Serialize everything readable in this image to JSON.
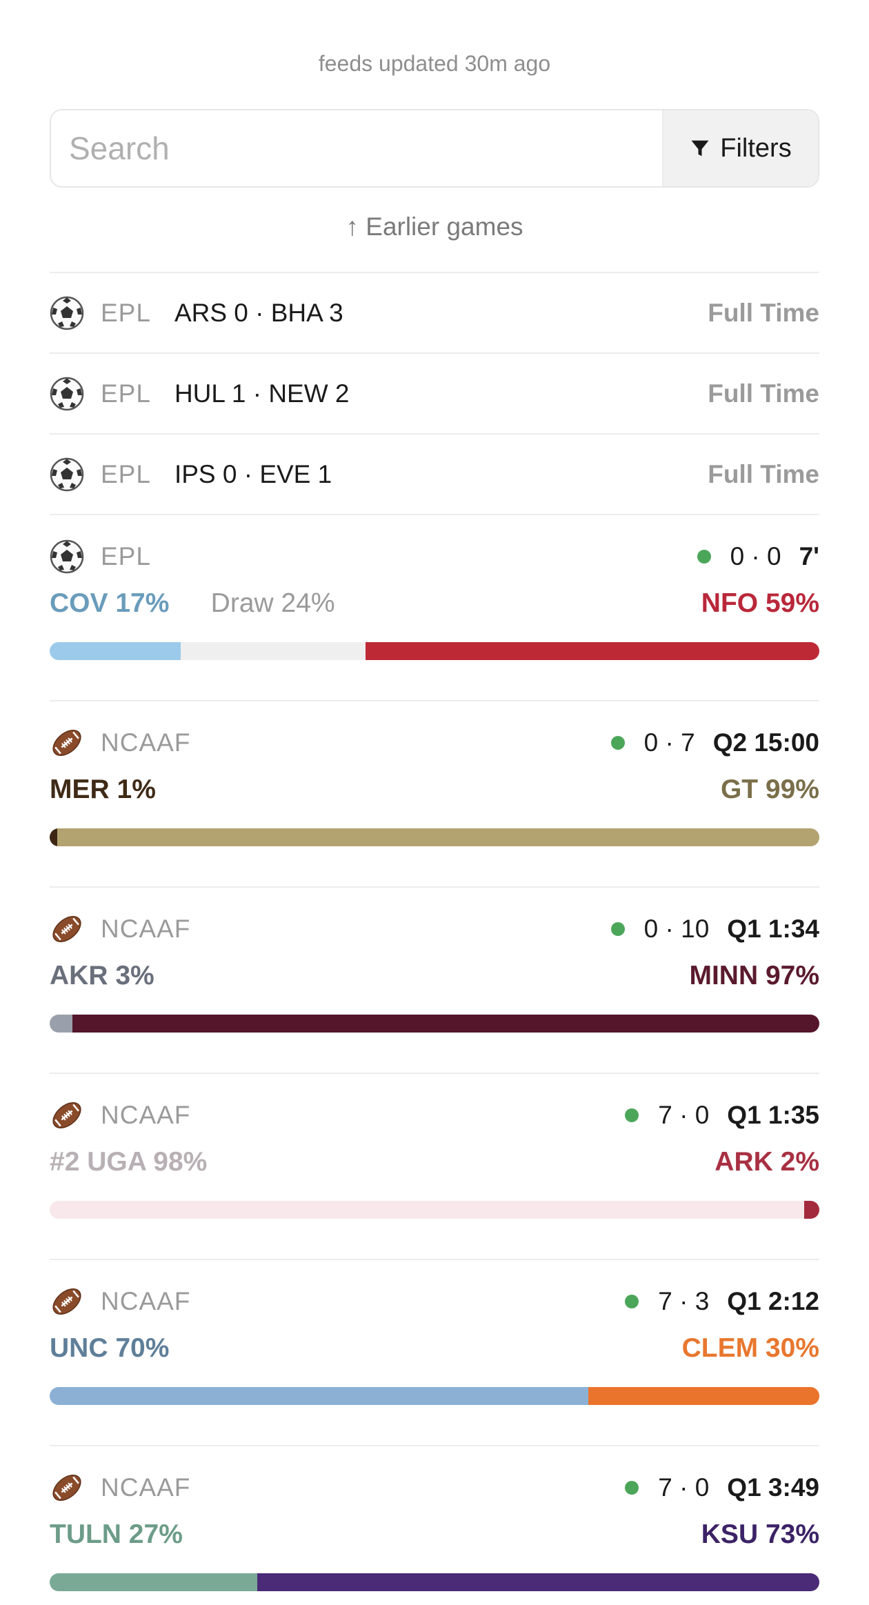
{
  "status": {
    "updated_text": "feeds updated 30m ago"
  },
  "search": {
    "placeholder": "Search",
    "value": ""
  },
  "filters": {
    "label": "Filters"
  },
  "earlier_games": {
    "label": "↑ Earlier games"
  },
  "colors": {
    "live_dot": "#4ca65a",
    "muted_text": "#9a9a9a",
    "draw_segment": "#efefef"
  },
  "finished_games": [
    {
      "sport_icon": "soccer-ball-icon",
      "league": "EPL",
      "score": "ARS 0 · BHA 3",
      "status": "Full Time"
    },
    {
      "sport_icon": "soccer-ball-icon",
      "league": "EPL",
      "score": "HUL 1 · NEW 2",
      "status": "Full Time"
    },
    {
      "sport_icon": "soccer-ball-icon",
      "league": "EPL",
      "score": "IPS 0 · EVE 1",
      "status": "Full Time"
    }
  ],
  "live_games": [
    {
      "sport_icon": "soccer-ball-icon",
      "league": "EPL",
      "score": "0 · 0",
      "clock": "7'",
      "home": {
        "label": "COV 17%",
        "prob": 17,
        "color": "#6a9cbb",
        "bar_color": "#9ccaea"
      },
      "draw": {
        "label": "Draw 24%",
        "prob": 24
      },
      "away": {
        "label": "NFO 59%",
        "prob": 59,
        "color": "#b9283a",
        "bar_color": "#bd2a36"
      }
    },
    {
      "sport_icon": "football-icon",
      "league": "NCAAF",
      "score": "0 · 7",
      "clock": "Q2 15:00",
      "home": {
        "label": "MER 1%",
        "prob": 1,
        "color": "#3f2a16",
        "bar_color": "#3d2614"
      },
      "away": {
        "label": "GT 99%",
        "prob": 99,
        "color": "#7a6f4a",
        "bar_color": "#b3a370"
      }
    },
    {
      "sport_icon": "football-icon",
      "league": "NCAAF",
      "score": "0 · 10",
      "clock": "Q1 1:34",
      "home": {
        "label": "AKR 3%",
        "prob": 3,
        "color": "#6a6f7c",
        "bar_color": "#9aa0ab"
      },
      "away": {
        "label": "MINN 97%",
        "prob": 97,
        "color": "#5a1a2e",
        "bar_color": "#55152b"
      }
    },
    {
      "sport_icon": "football-icon",
      "league": "NCAAF",
      "score": "7 · 0",
      "clock": "Q1 1:35",
      "home": {
        "label": "#2 UGA 98%",
        "prob": 98,
        "color": "#b8b0b4",
        "bar_color": "#f8e8ec"
      },
      "away": {
        "label": "ARK 2%",
        "prob": 2,
        "color": "#a83042",
        "bar_color": "#a32a3c"
      }
    },
    {
      "sport_icon": "football-icon",
      "league": "NCAAF",
      "score": "7 · 3",
      "clock": "Q1 2:12",
      "home": {
        "label": "UNC 70%",
        "prob": 70,
        "color": "#5f7f99",
        "bar_color": "#8cb0d4"
      },
      "away": {
        "label": "CLEM 30%",
        "prob": 30,
        "color": "#e8772e",
        "bar_color": "#ea742c"
      }
    },
    {
      "sport_icon": "football-icon",
      "league": "NCAAF",
      "score": "7 · 0",
      "clock": "Q1 3:49",
      "home": {
        "label": "TULN 27%",
        "prob": 27,
        "color": "#6c9c88",
        "bar_color": "#7aaa96"
      },
      "away": {
        "label": "KSU 73%",
        "prob": 73,
        "color": "#3c2266",
        "bar_color": "#4b2a77"
      }
    }
  ]
}
